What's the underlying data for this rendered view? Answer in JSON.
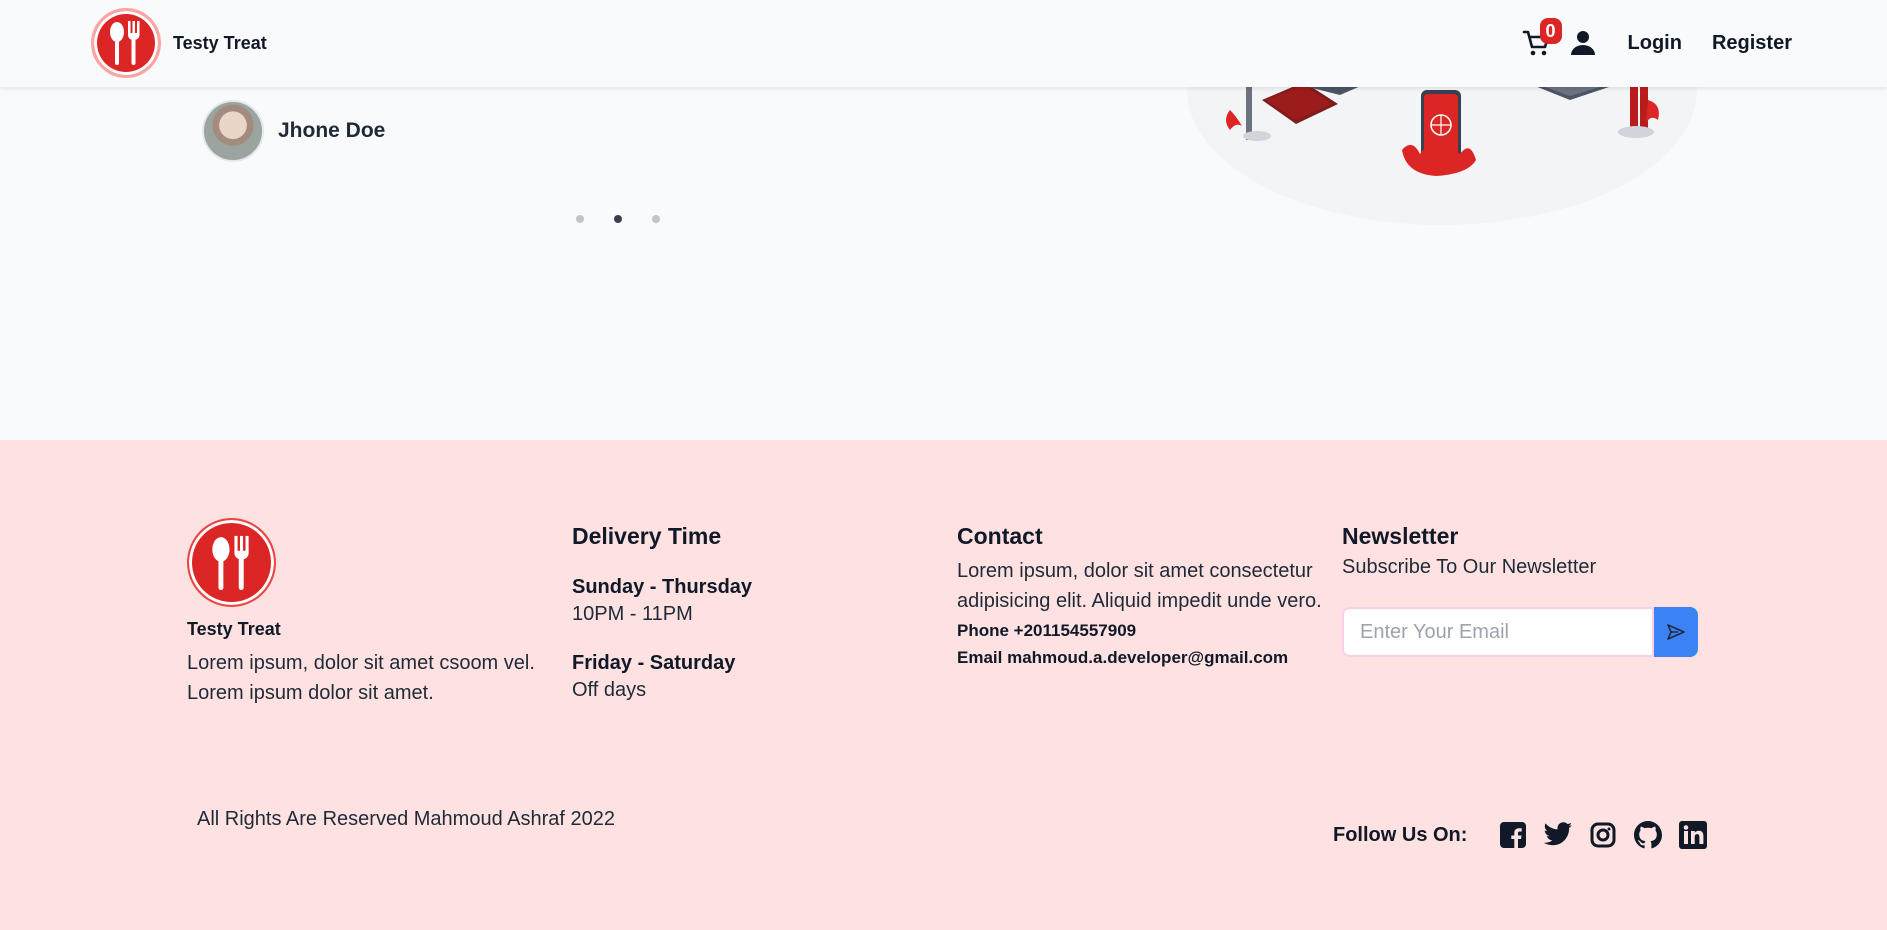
{
  "header": {
    "brand_name": "Testy Treat",
    "cart_count": "0",
    "login_label": "Login",
    "register_label": "Register"
  },
  "testimonial": {
    "author_name": "Jhone Doe",
    "active_slide": 2,
    "slide_count": 3
  },
  "footer": {
    "brand_name": "Testy Treat",
    "brand_text": "Lorem ipsum, dolor sit amet csoom vel. Lorem ipsum dolor sit amet.",
    "delivery": {
      "title": "Delivery Time",
      "day1": "Sunday - Thursday",
      "hours1": "10PM - 11PM",
      "day2": "Friday - Saturday",
      "hours2": "Off days"
    },
    "contact": {
      "title": "Contact",
      "text": "Lorem ipsum, dolor sit amet consectetur adipisicing elit. Aliquid impedit unde vero.",
      "phone": "Phone +201154557909",
      "email": "Email mahmoud.a.developer@gmail.com"
    },
    "newsletter": {
      "title": "Newsletter",
      "subtitle": "Subscribe To Our Newsletter",
      "placeholder": "Enter Your Email",
      "value": ""
    },
    "copyright": "All Rights Are Reserved Mahmoud Ashraf 2022",
    "follow_label": "Follow Us On:",
    "socials": [
      "facebook-icon",
      "twitter-icon",
      "instagram-icon",
      "github-icon",
      "linkedin-icon"
    ]
  },
  "colors": {
    "brand_red": "#dc2626",
    "footer_bg": "#fee2e2",
    "send_button": "#3b82f6",
    "page_bg": "#f9fafb"
  }
}
